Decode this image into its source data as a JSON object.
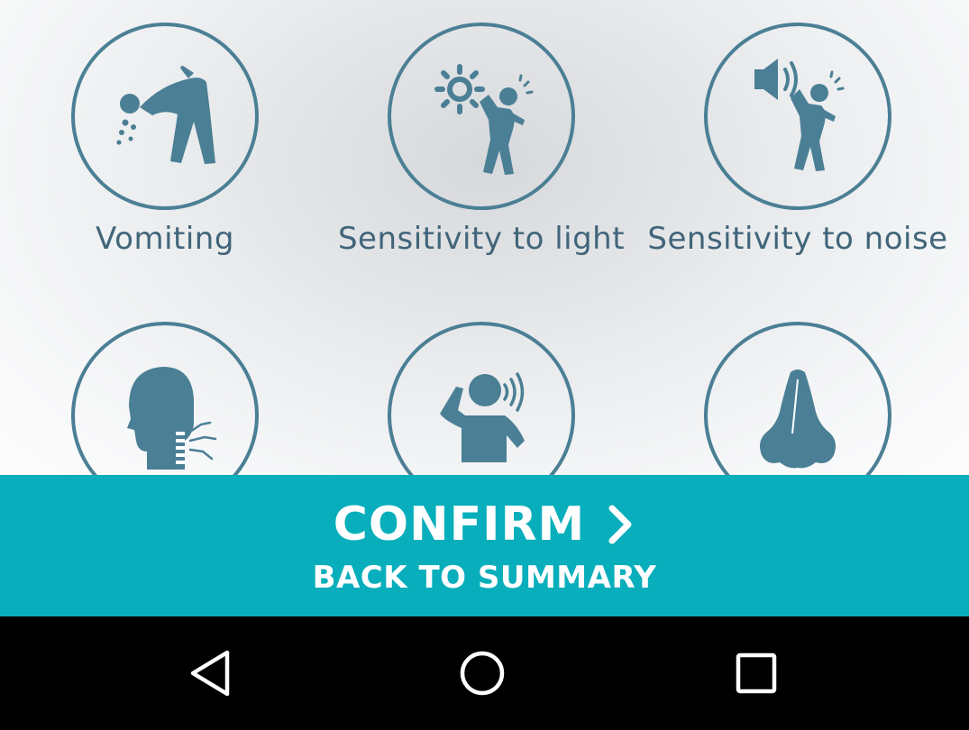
{
  "symptoms": [
    {
      "label": "Vomiting",
      "icon": "vomiting-icon"
    },
    {
      "label": "Sensitivity to light",
      "icon": "light-sensitivity-icon"
    },
    {
      "label": "Sensitivity to noise",
      "icon": "noise-sensitivity-icon"
    },
    {
      "label": "",
      "icon": "neck-pain-icon"
    },
    {
      "label": "",
      "icon": "tinnitus-icon"
    },
    {
      "label": "",
      "icon": "nose-icon"
    }
  ],
  "actions": {
    "confirm_label": "CONFIRM",
    "back_label": "BACK TO SUMMARY"
  },
  "nav": {
    "back": "back-icon",
    "home": "home-icon",
    "recents": "recents-icon"
  },
  "colors": {
    "accent": "#08aebb",
    "icon": "#4b7f95",
    "text": "#41657a"
  }
}
